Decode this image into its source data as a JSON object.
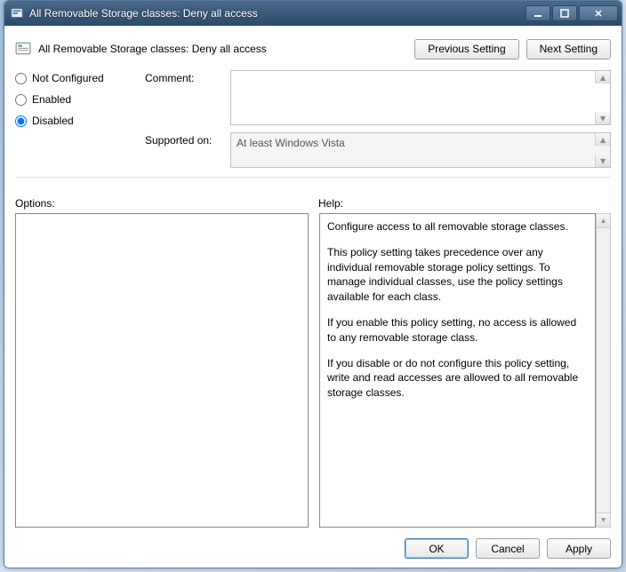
{
  "window": {
    "title": "All Removable Storage classes: Deny all access"
  },
  "header": {
    "title": "All Removable Storage classes: Deny all access",
    "prev_label": "Previous Setting",
    "next_label": "Next Setting"
  },
  "state": {
    "not_configured_label": "Not Configured",
    "enabled_label": "Enabled",
    "disabled_label": "Disabled",
    "selected": "disabled"
  },
  "fields": {
    "comment_label": "Comment:",
    "comment_value": "",
    "supported_label": "Supported on:",
    "supported_value": "At least Windows Vista"
  },
  "sections": {
    "options_label": "Options:",
    "help_label": "Help:"
  },
  "help": {
    "p1": "Configure access to all removable storage classes.",
    "p2": "This policy setting takes precedence over any individual removable storage policy settings. To manage individual classes, use the policy settings available for each class.",
    "p3": "If you enable this policy setting, no access is allowed to any removable storage class.",
    "p4": "If you disable or do not configure this policy setting, write and read accesses are allowed to all removable storage classes."
  },
  "footer": {
    "ok_label": "OK",
    "cancel_label": "Cancel",
    "apply_label": "Apply"
  }
}
